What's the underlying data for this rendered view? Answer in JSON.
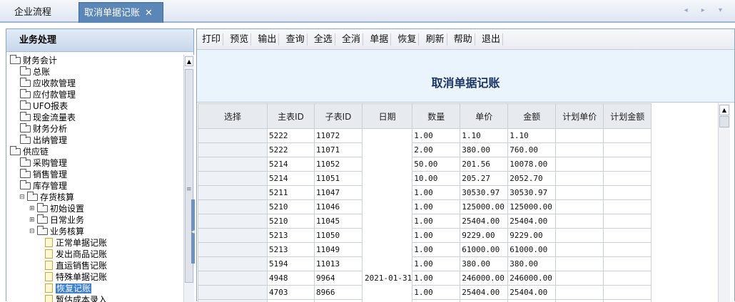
{
  "tabs": [
    {
      "label": "企业流程"
    },
    {
      "label": "取消单据记账",
      "close": "✕"
    }
  ],
  "nav_arrows": "◂ ▸ ▾",
  "sidebar": {
    "title": "业务处理",
    "tree": [
      {
        "label": "财务会计",
        "level": 0,
        "icon": "folder-open-icon"
      },
      {
        "label": "总账",
        "level": 1,
        "icon": "folder-icon"
      },
      {
        "label": "应收款管理",
        "level": 1,
        "icon": "folder-icon"
      },
      {
        "label": "应付款管理",
        "level": 1,
        "icon": "folder-icon"
      },
      {
        "label": "UFO报表",
        "level": 1,
        "icon": "folder-icon"
      },
      {
        "label": "现金流量表",
        "level": 1,
        "icon": "folder-icon"
      },
      {
        "label": "财务分析",
        "level": 1,
        "icon": "folder-icon"
      },
      {
        "label": "出纳管理",
        "level": 1,
        "icon": "folder-icon"
      },
      {
        "label": "供应链",
        "level": 0,
        "icon": "folder-open-icon"
      },
      {
        "label": "采购管理",
        "level": 1,
        "icon": "folder-icon"
      },
      {
        "label": "销售管理",
        "level": 1,
        "icon": "folder-icon"
      },
      {
        "label": "库存管理",
        "level": 1,
        "icon": "folder-icon"
      },
      {
        "label": "存货核算",
        "level": 1,
        "icon": "folder-open-icon",
        "toggle": "⊟"
      },
      {
        "label": "初始设置",
        "level": 2,
        "icon": "folder-icon",
        "toggle": "⊞"
      },
      {
        "label": "日常业务",
        "level": 2,
        "icon": "folder-icon",
        "toggle": "⊞"
      },
      {
        "label": "业务核算",
        "level": 2,
        "icon": "folder-open-icon",
        "toggle": "⊟"
      },
      {
        "label": "正常单据记账",
        "level": 3,
        "icon": "document-icon"
      },
      {
        "label": "发出商品记账",
        "level": 3,
        "icon": "document-icon"
      },
      {
        "label": "直运销售记账",
        "level": 3,
        "icon": "document-icon"
      },
      {
        "label": "特殊单据记账",
        "level": 3,
        "icon": "document-icon"
      },
      {
        "label": "恢复记账",
        "level": 3,
        "icon": "document-icon",
        "selected": true
      },
      {
        "label": "暂估成本录入",
        "level": 3,
        "icon": "document-icon"
      }
    ]
  },
  "toolbar": {
    "buttons": [
      "打印",
      "预览",
      "输出",
      "查询",
      "全选",
      "全消",
      "单据",
      "恢复",
      "刷新",
      "帮助",
      "退出"
    ]
  },
  "main": {
    "title": "取消单据记账",
    "columns": [
      "选择",
      "主表ID",
      "子表ID",
      "日期",
      "数量",
      "单价",
      "金额",
      "计划单价",
      "计划金额"
    ],
    "date": "2021-01-31",
    "rows": [
      {
        "main_id": "5222",
        "sub_id": "11072",
        "qty": "1.00",
        "price": "1.10",
        "amount": "1.10"
      },
      {
        "main_id": "5222",
        "sub_id": "11071",
        "qty": "2.00",
        "price": "380.00",
        "amount": "760.00"
      },
      {
        "main_id": "5214",
        "sub_id": "11052",
        "qty": "50.00",
        "price": "201.56",
        "amount": "10078.00"
      },
      {
        "main_id": "5214",
        "sub_id": "11051",
        "qty": "10.00",
        "price": "205.27",
        "amount": "2052.70"
      },
      {
        "main_id": "5211",
        "sub_id": "11047",
        "qty": "1.00",
        "price": "30530.97",
        "amount": "30530.97"
      },
      {
        "main_id": "5210",
        "sub_id": "11046",
        "qty": "1.00",
        "price": "125000.00",
        "amount": "125000.00"
      },
      {
        "main_id": "5210",
        "sub_id": "11045",
        "qty": "1.00",
        "price": "25404.00",
        "amount": "25404.00"
      },
      {
        "main_id": "5213",
        "sub_id": "11050",
        "qty": "1.00",
        "price": "9229.00",
        "amount": "9229.00"
      },
      {
        "main_id": "5213",
        "sub_id": "11049",
        "qty": "1.00",
        "price": "61000.00",
        "amount": "61000.00"
      },
      {
        "main_id": "5194",
        "sub_id": "11013",
        "qty": "1.00",
        "price": "380.00",
        "amount": "380.00"
      },
      {
        "main_id": "4948",
        "sub_id": "9964",
        "qty": "1.00",
        "price": "246000.00",
        "amount": "246000.00"
      },
      {
        "main_id": "4703",
        "sub_id": "8966",
        "qty": "1.00",
        "price": "25404.00",
        "amount": "25404.00"
      }
    ]
  },
  "colors": {
    "tab_active": "#5a86b8",
    "title_text": "#1b3666",
    "title_bg": "#eaf4fc",
    "selection": "#3a7fd6"
  }
}
